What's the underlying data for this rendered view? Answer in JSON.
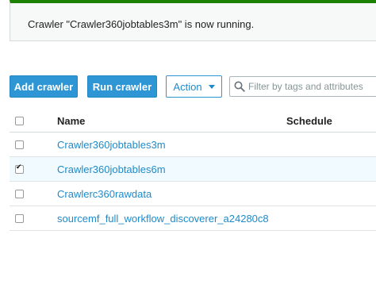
{
  "banner": {
    "message": "Crawler \"Crawler360jobtables3m\" is now running."
  },
  "toolbar": {
    "add_label": "Add crawler",
    "run_label": "Run crawler",
    "action_label": "Action",
    "search_placeholder": "Filter by tags and attributes"
  },
  "table": {
    "columns": [
      "Name",
      "Schedule"
    ],
    "rows": [
      {
        "name": "Crawler360jobtables3m",
        "selected": false
      },
      {
        "name": "Crawler360jobtables6m",
        "selected": true
      },
      {
        "name": "Crawlerc360rawdata",
        "selected": false
      },
      {
        "name": "sourcemf_full_workflow_discoverer_a24280c8",
        "selected": false
      }
    ]
  },
  "colors": {
    "success_accent": "#1d8102",
    "primary_button": "#2e96d4",
    "link": "#1f8ac9",
    "selected_row": "#f1faff"
  },
  "icons": {
    "search": "search-icon",
    "action_caret": "caret-down-icon"
  }
}
